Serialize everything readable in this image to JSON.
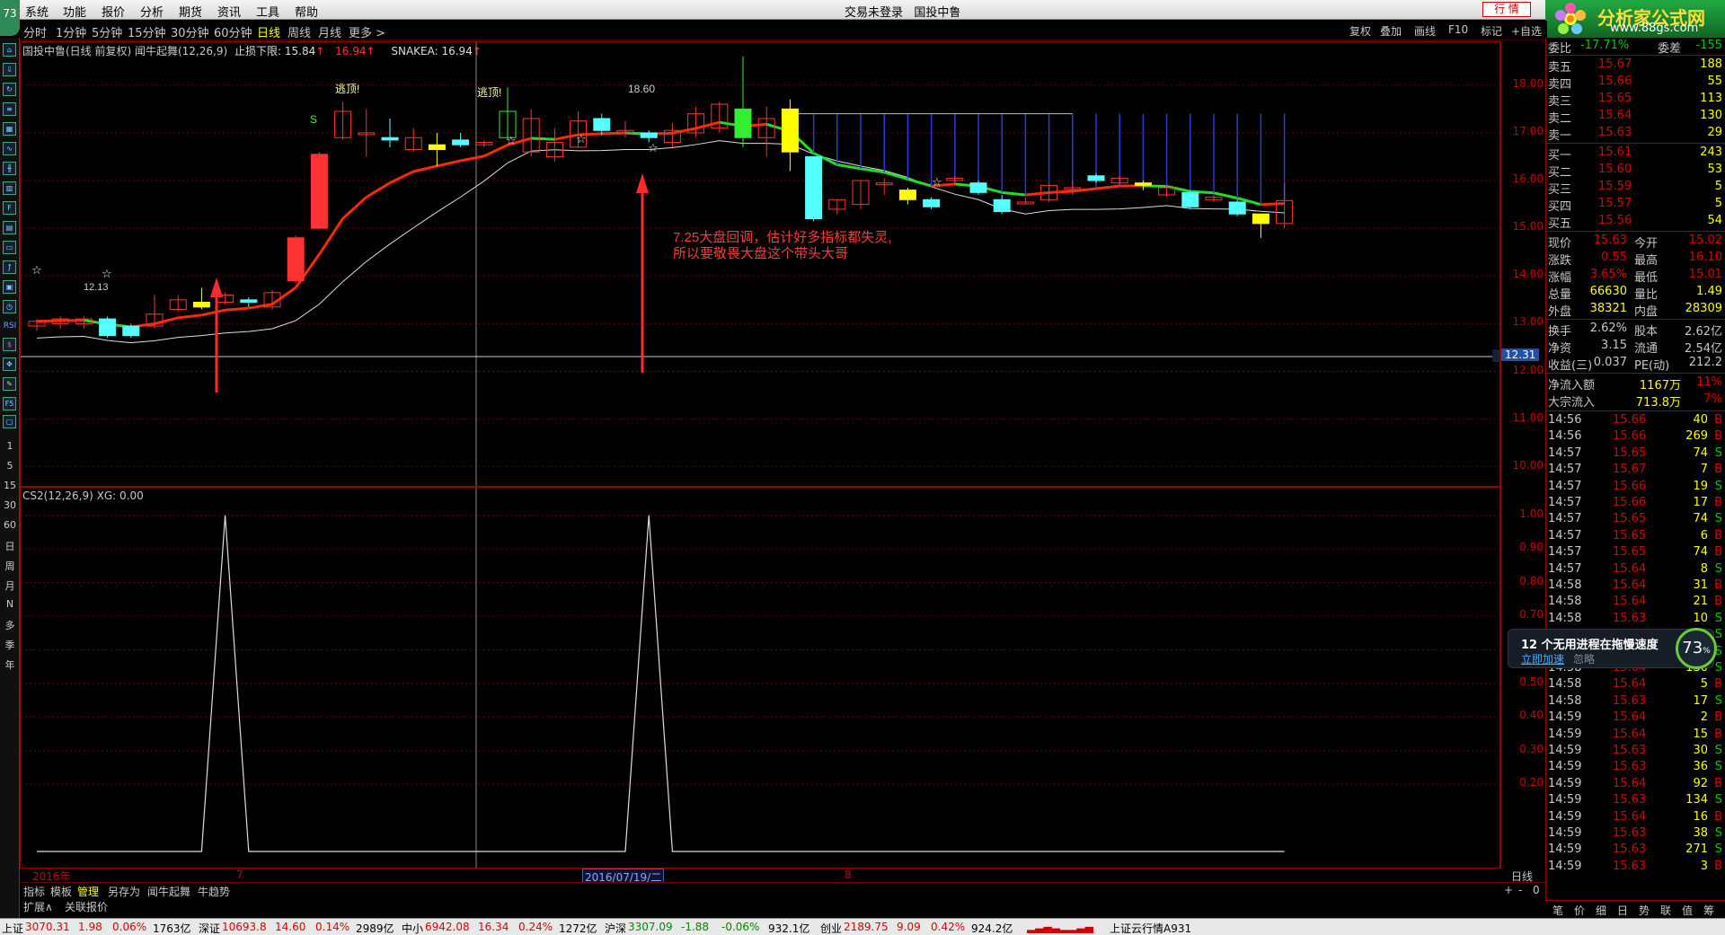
{
  "app": {
    "logo_num": "73",
    "title": "交易未登录",
    "title2": "国投中鲁",
    "trade_label": "行 情"
  },
  "menu": [
    "系统",
    "功能",
    "报价",
    "分析",
    "期货",
    "资讯",
    "工具",
    "帮助"
  ],
  "periods": [
    "分时",
    "1分钟",
    "5分钟",
    "15分钟",
    "30分钟",
    "60分钟",
    "日线",
    "周线",
    "月线",
    "更多 >"
  ],
  "active_period": "日线",
  "tools": [
    "复权",
    "叠加",
    "画线",
    "F10",
    "标记",
    "+自选"
  ],
  "left_tools_text": [
    "1",
    "5",
    "15",
    "30",
    "60",
    "日",
    "周",
    "月",
    "N",
    "多",
    "季",
    "年"
  ],
  "left_tools_icons": [
    "F5",
    "RSI"
  ],
  "main_legend": {
    "name": "国投中鲁(日线 前复权) 闻牛起舞(12,26,9)",
    "stop_label": "止损下限: 15.84",
    "stop_arrow": "↑",
    "high_val": "16.94",
    "snake": "SNAKEA: 16.94",
    "snake_arrow": "↑"
  },
  "sub_legend": "CS2(12,26,9)  XG: 0.00",
  "annotations": {
    "escape1": "逃顶!",
    "escape2": "逃顶!",
    "peak": "18.60",
    "low": "12.13",
    "s_mark": "S",
    "note_line1": "7.25大盘回调，估计好多指标都失灵,",
    "note_line2": "所以要敬畏大盘这个带头大哥",
    "cursor_price": "12.31"
  },
  "main_y_ticks": [
    "18.00",
    "17.00",
    "16.00",
    "15.00",
    "14.00",
    "13.00",
    "12.00",
    "11.00",
    "10.00"
  ],
  "sub_y_ticks": [
    "1.00",
    "0.90",
    "0.80",
    "0.70",
    "0.60",
    "0.50",
    "0.40",
    "0.30",
    "0.20"
  ],
  "date_axis": {
    "start": "2016年",
    "m7": "7",
    "cursor": "2016/07/19/二",
    "m8": "8",
    "label": "日线"
  },
  "bottom_tabs": [
    "指标",
    "模板",
    "管理",
    "另存为",
    "闻牛起舞",
    "牛趋势"
  ],
  "active_bottom_tab": "管理",
  "ext_tabs": [
    "扩展∧",
    "关联报价"
  ],
  "chart_data": {
    "type": "candlestick",
    "ylim": [
      9.6,
      18.9
    ],
    "candles": [
      [
        12.95,
        13.05,
        12.85,
        13.1
      ],
      [
        13.0,
        13.1,
        12.9,
        13.15
      ],
      [
        13.0,
        13.1,
        12.9,
        13.15
      ],
      [
        13.1,
        12.75,
        12.7,
        13.15
      ],
      [
        12.95,
        12.75,
        12.7,
        13.0
      ],
      [
        12.95,
        13.2,
        12.9,
        13.6
      ],
      [
        13.3,
        13.5,
        13.25,
        13.6
      ],
      [
        13.45,
        13.35,
        13.3,
        13.75
      ],
      [
        13.45,
        13.6,
        13.4,
        13.65
      ],
      [
        13.5,
        13.45,
        13.35,
        13.55
      ],
      [
        13.35,
        13.65,
        13.3,
        13.7
      ],
      [
        13.9,
        14.8,
        13.85,
        14.85
      ],
      [
        15.0,
        16.55,
        15.0,
        16.6
      ],
      [
        16.9,
        17.45,
        16.85,
        17.65
      ],
      [
        17.0,
        17.0,
        16.5,
        17.5
      ],
      [
        16.9,
        16.85,
        16.7,
        17.3
      ],
      [
        16.65,
        16.9,
        16.6,
        17.1
      ],
      [
        16.75,
        16.65,
        16.3,
        17.0
      ],
      [
        16.85,
        16.75,
        16.7,
        17.0
      ],
      [
        16.75,
        16.8,
        16.7,
        16.85
      ],
      [
        16.9,
        17.45,
        16.85,
        17.95
      ],
      [
        16.6,
        17.3,
        16.5,
        17.5
      ],
      [
        16.5,
        16.8,
        16.4,
        17.1
      ],
      [
        16.7,
        17.25,
        16.7,
        17.45
      ],
      [
        17.3,
        17.05,
        16.95,
        17.4
      ],
      [
        17.0,
        17.05,
        16.9,
        17.25
      ],
      [
        17.0,
        16.9,
        16.8,
        17.05
      ],
      [
        16.8,
        17.05,
        16.7,
        17.2
      ],
      [
        17.0,
        17.4,
        16.9,
        17.55
      ],
      [
        17.1,
        17.6,
        17.0,
        17.65
      ],
      [
        17.5,
        16.9,
        16.7,
        18.6
      ],
      [
        16.9,
        17.3,
        16.5,
        17.55
      ],
      [
        17.5,
        16.6,
        16.2,
        17.7
      ],
      [
        16.5,
        15.2,
        15.15,
        16.5
      ],
      [
        15.4,
        15.6,
        15.3,
        15.6
      ],
      [
        15.5,
        16.0,
        15.4,
        16.0
      ],
      [
        15.95,
        15.95,
        15.7,
        16.05
      ],
      [
        15.8,
        15.6,
        15.5,
        15.85
      ],
      [
        15.6,
        15.45,
        15.4,
        15.65
      ],
      [
        16.0,
        16.05,
        15.9,
        16.1
      ],
      [
        15.95,
        15.75,
        15.7,
        16.0
      ],
      [
        15.6,
        15.35,
        15.3,
        15.7
      ],
      [
        15.55,
        15.55,
        15.5,
        15.65
      ],
      [
        15.6,
        15.9,
        15.55,
        15.9
      ],
      [
        15.85,
        15.85,
        15.7,
        16.0
      ],
      [
        16.1,
        16.0,
        15.95,
        16.15
      ],
      [
        15.95,
        16.05,
        15.9,
        16.1
      ],
      [
        15.95,
        15.9,
        15.8,
        16.0
      ],
      [
        15.7,
        15.85,
        15.65,
        15.9
      ],
      [
        15.75,
        15.45,
        15.4,
        15.8
      ],
      [
        15.6,
        15.65,
        15.55,
        15.7
      ],
      [
        15.55,
        15.3,
        15.25,
        15.6
      ],
      [
        15.3,
        15.1,
        14.8,
        15.3
      ],
      [
        15.1,
        15.58,
        15.0,
        15.95
      ]
    ],
    "xg_signal_at": [
      8,
      26
    ],
    "sub_ylim": [
      0,
      1.05
    ]
  },
  "quote": {
    "wb_label": "委比",
    "wb_val": "-17.71%",
    "wc_label": "委差",
    "wc_val": "-155",
    "asks": [
      [
        "卖五",
        "15.67",
        "188"
      ],
      [
        "卖四",
        "15.66",
        "55"
      ],
      [
        "卖三",
        "15.65",
        "113"
      ],
      [
        "卖二",
        "15.64",
        "130"
      ],
      [
        "卖一",
        "15.63",
        "29"
      ]
    ],
    "bids": [
      [
        "买一",
        "15.61",
        "243"
      ],
      [
        "买二",
        "15.60",
        "53"
      ],
      [
        "买三",
        "15.59",
        "5"
      ],
      [
        "买四",
        "15.57",
        "5"
      ],
      [
        "买五",
        "15.56",
        "54"
      ]
    ],
    "stats": [
      [
        "现价",
        "15.63",
        "今开",
        "15.02"
      ],
      [
        "涨跌",
        "0.55",
        "最高",
        "16.10"
      ],
      [
        "涨幅",
        "3.65%",
        "最低",
        "15.01"
      ],
      [
        "总量",
        "66630",
        "量比",
        "1.49"
      ],
      [
        "外盘",
        "38321",
        "内盘",
        "28309"
      ]
    ],
    "stats2": [
      [
        "换手",
        "2.62%",
        "股本",
        "2.62亿"
      ],
      [
        "净资",
        "3.15",
        "流通",
        "2.54亿"
      ],
      [
        "收益(三)",
        "0.037",
        "PE(动)",
        "212.2"
      ]
    ],
    "flows": [
      [
        "净流入额",
        "1167万",
        "11%"
      ],
      [
        "大宗流入",
        "713.8万",
        "7%"
      ]
    ],
    "ticks": [
      [
        "14:56",
        "15.66",
        "40",
        "B"
      ],
      [
        "14:56",
        "15.66",
        "269",
        "B"
      ],
      [
        "14:57",
        "15.65",
        "74",
        "S"
      ],
      [
        "14:57",
        "15.67",
        "7",
        "B"
      ],
      [
        "14:57",
        "15.66",
        "19",
        "S"
      ],
      [
        "14:57",
        "15.66",
        "17",
        "B"
      ],
      [
        "14:57",
        "15.65",
        "74",
        "S"
      ],
      [
        "14:57",
        "15.65",
        "6",
        "B"
      ],
      [
        "14:57",
        "15.65",
        "74",
        "B"
      ],
      [
        "14:57",
        "15.64",
        "8",
        "S"
      ],
      [
        "14:58",
        "15.64",
        "31",
        "B"
      ],
      [
        "14:58",
        "15.64",
        "21",
        "B"
      ],
      [
        "14:58",
        "15.63",
        "10",
        "S"
      ],
      [
        "14:58",
        "15.63",
        "",
        "S"
      ],
      [
        "14:58",
        "15.63",
        "",
        "S"
      ],
      [
        "14:58",
        "15.64",
        "130",
        "S"
      ],
      [
        "14:58",
        "15.64",
        "5",
        "B"
      ],
      [
        "14:58",
        "15.63",
        "17",
        "S"
      ],
      [
        "14:59",
        "15.64",
        "2",
        "B"
      ],
      [
        "14:59",
        "15.64",
        "15",
        "B"
      ],
      [
        "14:59",
        "15.63",
        "30",
        "S"
      ],
      [
        "14:59",
        "15.63",
        "36",
        "S"
      ],
      [
        "14:59",
        "15.64",
        "92",
        "B"
      ],
      [
        "14:59",
        "15.63",
        "134",
        "S"
      ],
      [
        "14:59",
        "15.64",
        "16",
        "B"
      ],
      [
        "14:59",
        "15.63",
        "38",
        "S"
      ],
      [
        "14:59",
        "15.63",
        "271",
        "S"
      ],
      [
        "14:59",
        "15.63",
        "3",
        "B"
      ]
    ],
    "panel_tabs": [
      "笔",
      "价",
      "细",
      "日",
      "势",
      "联",
      "值",
      "筹"
    ]
  },
  "popup": {
    "title": "12 个无用进程在拖慢速度",
    "action": "立即加速",
    "ignore": "忽略",
    "score": "73",
    "unit": "%"
  },
  "brand": {
    "name": "分析家公式网",
    "url": "www.88gs.com"
  },
  "status": [
    [
      "上证",
      "3070.31",
      "1.98",
      "0.06%",
      "1763亿"
    ],
    [
      "深证",
      "10693.8",
      "14.60",
      "0.14%",
      "2989亿"
    ],
    [
      "中小",
      "6942.08",
      "16.34",
      "0.24%",
      "1272亿"
    ],
    [
      "沪深",
      "3307.09",
      "-1.88",
      "-0.06%",
      "932.1亿"
    ],
    [
      "创业",
      "2189.75",
      "9.09",
      "0.42%",
      "924.2亿"
    ]
  ],
  "status_tail": "上证云行情A931",
  "colors": {
    "up": "#dd0000",
    "down": "#00cc00",
    "bull_candle": "#ff3333",
    "bear_candle": "#54ffff",
    "yellow": "#ffff00",
    "snake_up": "#ff2a00",
    "snake_dn": "#22dd22"
  }
}
